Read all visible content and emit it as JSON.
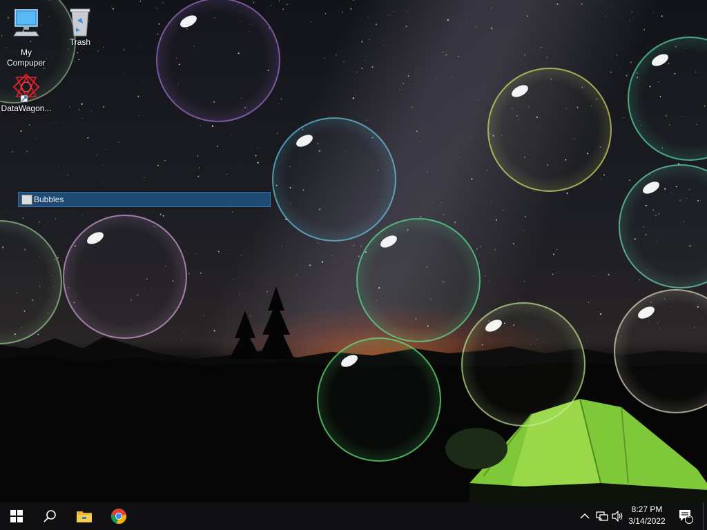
{
  "desktop": {
    "icons": [
      {
        "label": "My\nCompuper",
        "icon": "computer-icon"
      },
      {
        "label": "Trash",
        "icon": "recycle-bin-icon"
      },
      {
        "label": "DataWagon...",
        "icon": "datawagon-shortcut-icon"
      }
    ],
    "window": {
      "title": "Bubbles",
      "icon": "bubbles-app-icon"
    }
  },
  "taskbar": {
    "start": "windows-start-icon",
    "search": "search-icon",
    "pinned": [
      "file-explorer-icon",
      "chrome-icon"
    ],
    "tray": {
      "overflow_icon": "chevron-up-icon",
      "network_icon": "network-icon",
      "volume_icon": "volume-icon",
      "time": "8:27 PM",
      "date": "3/14/2022",
      "notification_count": "1"
    }
  },
  "colors": {
    "taskbar": "#101012",
    "window_title_bg": "#1f4a73",
    "bubble_colors": [
      "#b07ae0",
      "#6ccde8",
      "#d9e86a",
      "#5ee8a8",
      "#62e87a",
      "#d8a8e0",
      "#e8e0c8",
      "#a8d8a0"
    ]
  }
}
